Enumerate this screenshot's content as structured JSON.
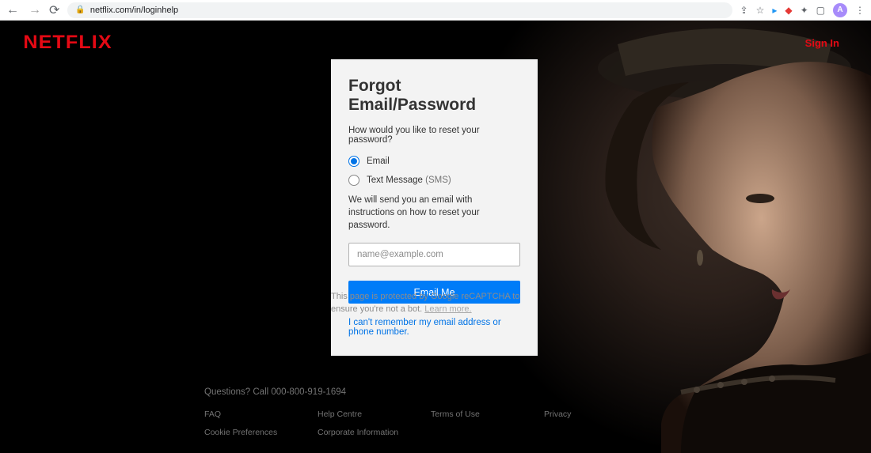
{
  "browser": {
    "url": "netflix.com/in/loginhelp",
    "avatar_letter": "A"
  },
  "header": {
    "logo": "NETFLIX",
    "signin": "Sign In"
  },
  "card": {
    "title": "Forgot Email/Password",
    "question": "How would you like to reset your password?",
    "opt_email": "Email",
    "opt_sms_prefix": "Text Message ",
    "opt_sms_suffix": "(SMS)",
    "desc": "We will send you an email with instructions on how to reset your password.",
    "placeholder": "name@example.com",
    "button": "Email Me",
    "cant_remember": "I can't remember my email address or phone number."
  },
  "recaptcha": {
    "text": "This page is protected by Google reCAPTCHA to ensure you're not a bot. ",
    "learn": "Learn more."
  },
  "footer": {
    "questions": "Questions? Call 000-800-919-1694",
    "links": [
      "FAQ",
      "Help Centre",
      "Terms of Use",
      "Privacy",
      "Cookie Preferences",
      "Corporate Information"
    ]
  }
}
